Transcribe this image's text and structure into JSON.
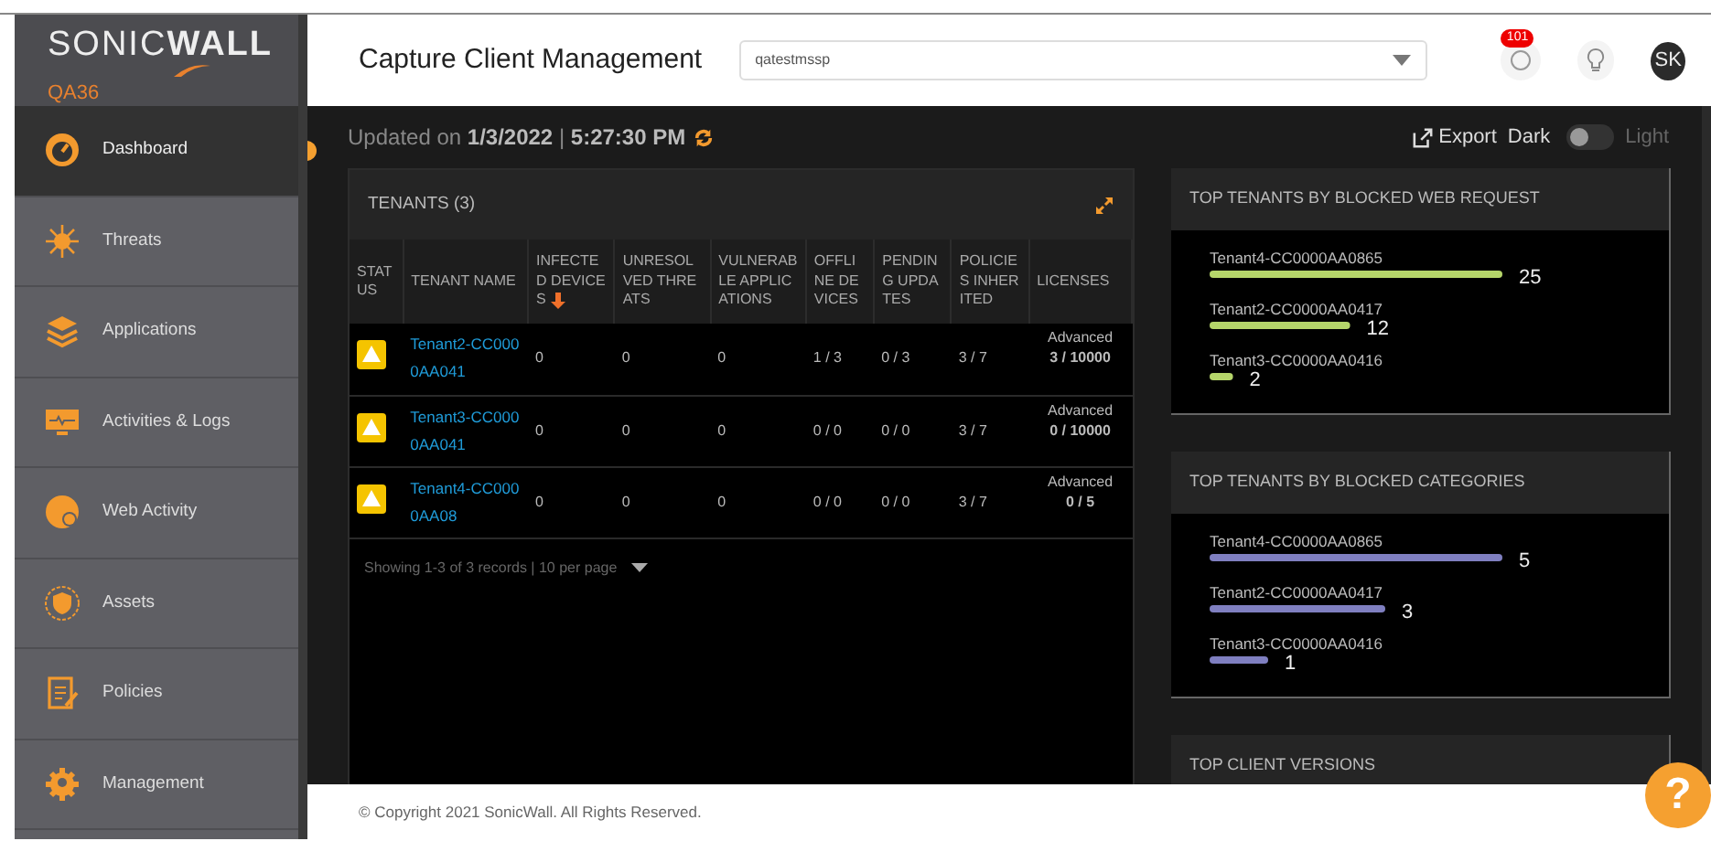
{
  "header": {
    "logo": "SONIC**WALL**",
    "instance": "QA36",
    "title": "Capture Client Management",
    "tenant_select": {
      "value": "qatestmssp"
    },
    "notifications": "101",
    "avatar": "SK"
  },
  "sidebar": {
    "items": [
      {
        "label": "Dashboard",
        "selected": true
      },
      {
        "label": "Threats",
        "selected": false
      },
      {
        "label": "Applications",
        "selected": false
      },
      {
        "label": "Activities & Logs",
        "selected": false
      },
      {
        "label": "Web Activity",
        "selected": false
      },
      {
        "label": "Assets",
        "selected": false
      },
      {
        "label": "Policies",
        "selected": false
      },
      {
        "label": "Management",
        "selected": false
      }
    ]
  },
  "toolbar": {
    "updated": "Updated on **1/3/2022** | **5:27:30 PM**",
    "export": "Export",
    "theme_dark": "Dark",
    "theme_light": "Light",
    "light_mode": false
  },
  "tenants": {
    "title": "TENANTS (3)",
    "columns": [
      {
        "label": "STATUS",
        "sorted": false
      },
      {
        "label": "TENANT NAME",
        "sorted": false
      },
      {
        "label": "INFECTED DEVICES",
        "sorted": true
      },
      {
        "label": "UNRESOLVED THREATS",
        "sorted": false
      },
      {
        "label": "VULNERABLE APPLICATIONS",
        "sorted": false
      },
      {
        "label": "OFFLINE DEVICES",
        "sorted": false
      },
      {
        "label": "PENDING UPDATES",
        "sorted": false
      },
      {
        "label": "POLICIES INHERITED",
        "sorted": false
      },
      {
        "label": "LICENSES",
        "sorted": false
      }
    ],
    "rows": [
      {
        "kind": "warning",
        "name": "Tenant2-CC0000AA041",
        "infected": "0",
        "unresolved": "0",
        "vulnerable": "0",
        "offline": "1 / 3",
        "pending": "0 / 3",
        "policies": "3 / 7",
        "license_type": "Advanced",
        "license_count": "3 / 10000"
      },
      {
        "kind": "warning",
        "name": "Tenant3-CC0000AA041",
        "infected": "0",
        "unresolved": "0",
        "vulnerable": "0",
        "offline": "0 / 0",
        "pending": "0 / 0",
        "policies": "3 / 7",
        "license_type": "Advanced",
        "license_count": "0 / 10000"
      },
      {
        "kind": "warning",
        "name": "Tenant4-CC0000AA08",
        "infected": "0",
        "unresolved": "0",
        "vulnerable": "0",
        "offline": "0 / 0",
        "pending": "0 / 0",
        "policies": "3 / 7",
        "license_type": "Advanced",
        "license_count": "0 / 5"
      }
    ],
    "pagination": "Showing 1-3 of 3 records | 10 per page"
  },
  "panels": [
    {
      "title": "TOP TENANTS BY BLOCKED WEB REQUEST",
      "chart_data": {
        "type": "bar",
        "orientation": "horizontal",
        "categories": [
          "Tenant4-CC0000AA0865",
          "Tenant2-CC0000AA0417",
          "Tenant3-CC0000AA0416"
        ],
        "series": [
          {
            "color": "#b5d56a",
            "values": [
              25,
              12,
              2
            ]
          }
        ],
        "data_labels": true
      }
    },
    {
      "title": "TOP TENANTS BY BLOCKED CATEGORIES",
      "chart_data": {
        "type": "bar",
        "orientation": "horizontal",
        "categories": [
          "Tenant4-CC0000AA0865",
          "Tenant2-CC0000AA0417",
          "Tenant3-CC0000AA0416"
        ],
        "series": [
          {
            "color": "#7f7fc0",
            "values": [
              5,
              3,
              1
            ]
          }
        ],
        "data_labels": true
      }
    },
    {
      "title": "TOP CLIENT VERSIONS"
    }
  ],
  "footer": {
    "copyright": "© Copyright 2021 SonicWall. All Rights Reserved.",
    "help": "?"
  }
}
